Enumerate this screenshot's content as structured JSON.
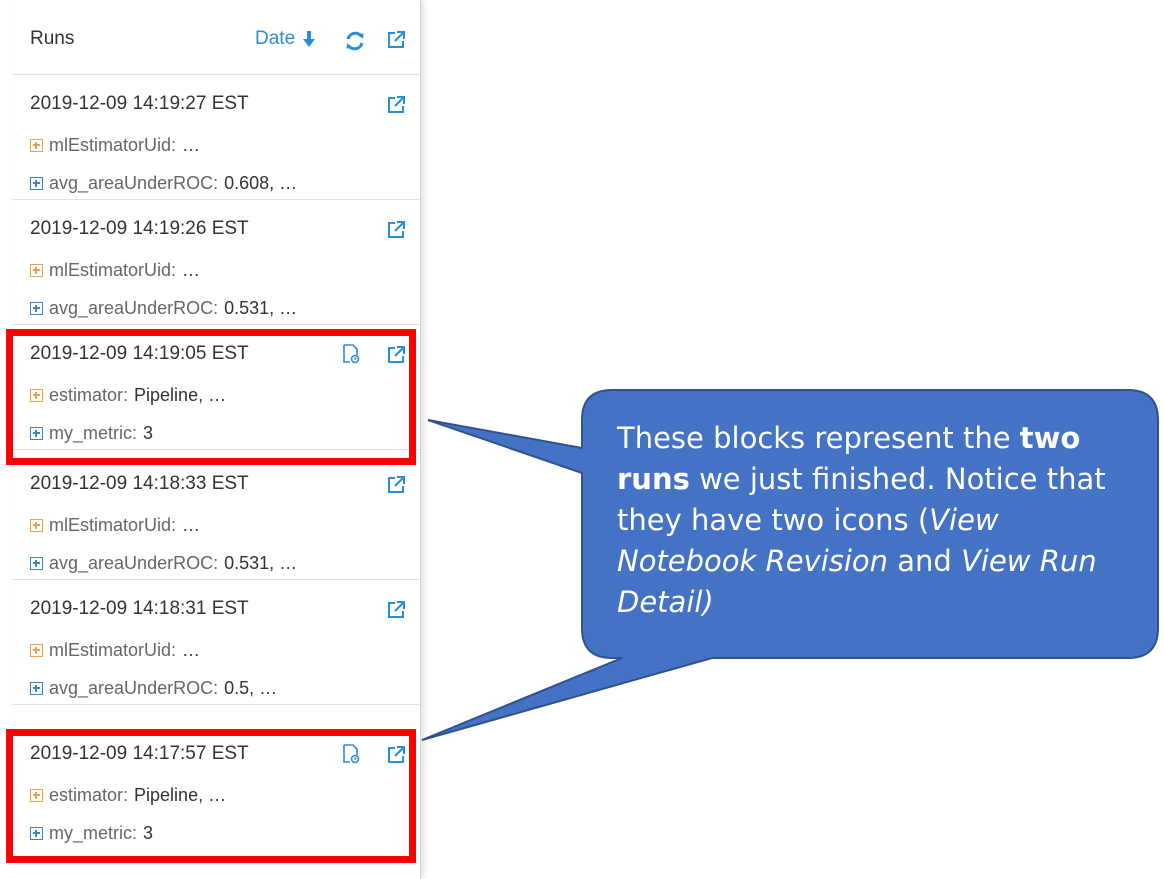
{
  "header": {
    "title": "Runs",
    "sort_label": "Date"
  },
  "runs": [
    {
      "timestamp": "2019-12-09 14:19:27 EST",
      "param_key": "mlEstimatorUid:",
      "param_value": "…",
      "metric_key": "avg_areaUnderROC:",
      "metric_value": "0.608, …"
    },
    {
      "timestamp": "2019-12-09 14:19:26 EST",
      "param_key": "mlEstimatorUid:",
      "param_value": "…",
      "metric_key": "avg_areaUnderROC:",
      "metric_value": "0.531, …"
    },
    {
      "timestamp": "2019-12-09 14:19:05 EST",
      "param_key": "estimator:",
      "param_value": "Pipeline, …",
      "metric_key": "my_metric:",
      "metric_value": "3"
    },
    {
      "timestamp": "2019-12-09 14:18:33 EST",
      "param_key": "mlEstimatorUid:",
      "param_value": "…",
      "metric_key": "avg_areaUnderROC:",
      "metric_value": "0.531, …"
    },
    {
      "timestamp": "2019-12-09 14:18:31 EST",
      "param_key": "mlEstimatorUid:",
      "param_value": "…",
      "metric_key": "avg_areaUnderROC:",
      "metric_value": "0.5, …"
    },
    {
      "timestamp": "2019-12-09 14:17:57 EST",
      "param_key": "estimator:",
      "param_value": "Pipeline, …",
      "metric_key": "my_metric:",
      "metric_value": "3"
    }
  ],
  "callout": {
    "t1": "These blocks represent the ",
    "t2": "two runs",
    "t3": " we just finished.  Notice that they have two icons (",
    "t4": "View Notebook Revision",
    "t5": " and ",
    "t6": "View Run Detail)"
  },
  "colors": {
    "link_blue": "#2a8ed6",
    "param_orange": "#f0a04b",
    "metric_blue": "#3a84c8",
    "highlight_red": "#ff0000",
    "callout_fill": "#4472c4",
    "callout_border": "#2f528f"
  },
  "icons": {
    "sort": "arrow-down-icon",
    "refresh": "refresh-icon",
    "external": "external-link-icon",
    "notebook": "notebook-revision-icon",
    "param_toggle": "expand-plus-icon",
    "metric_toggle": "expand-plus-icon"
  }
}
